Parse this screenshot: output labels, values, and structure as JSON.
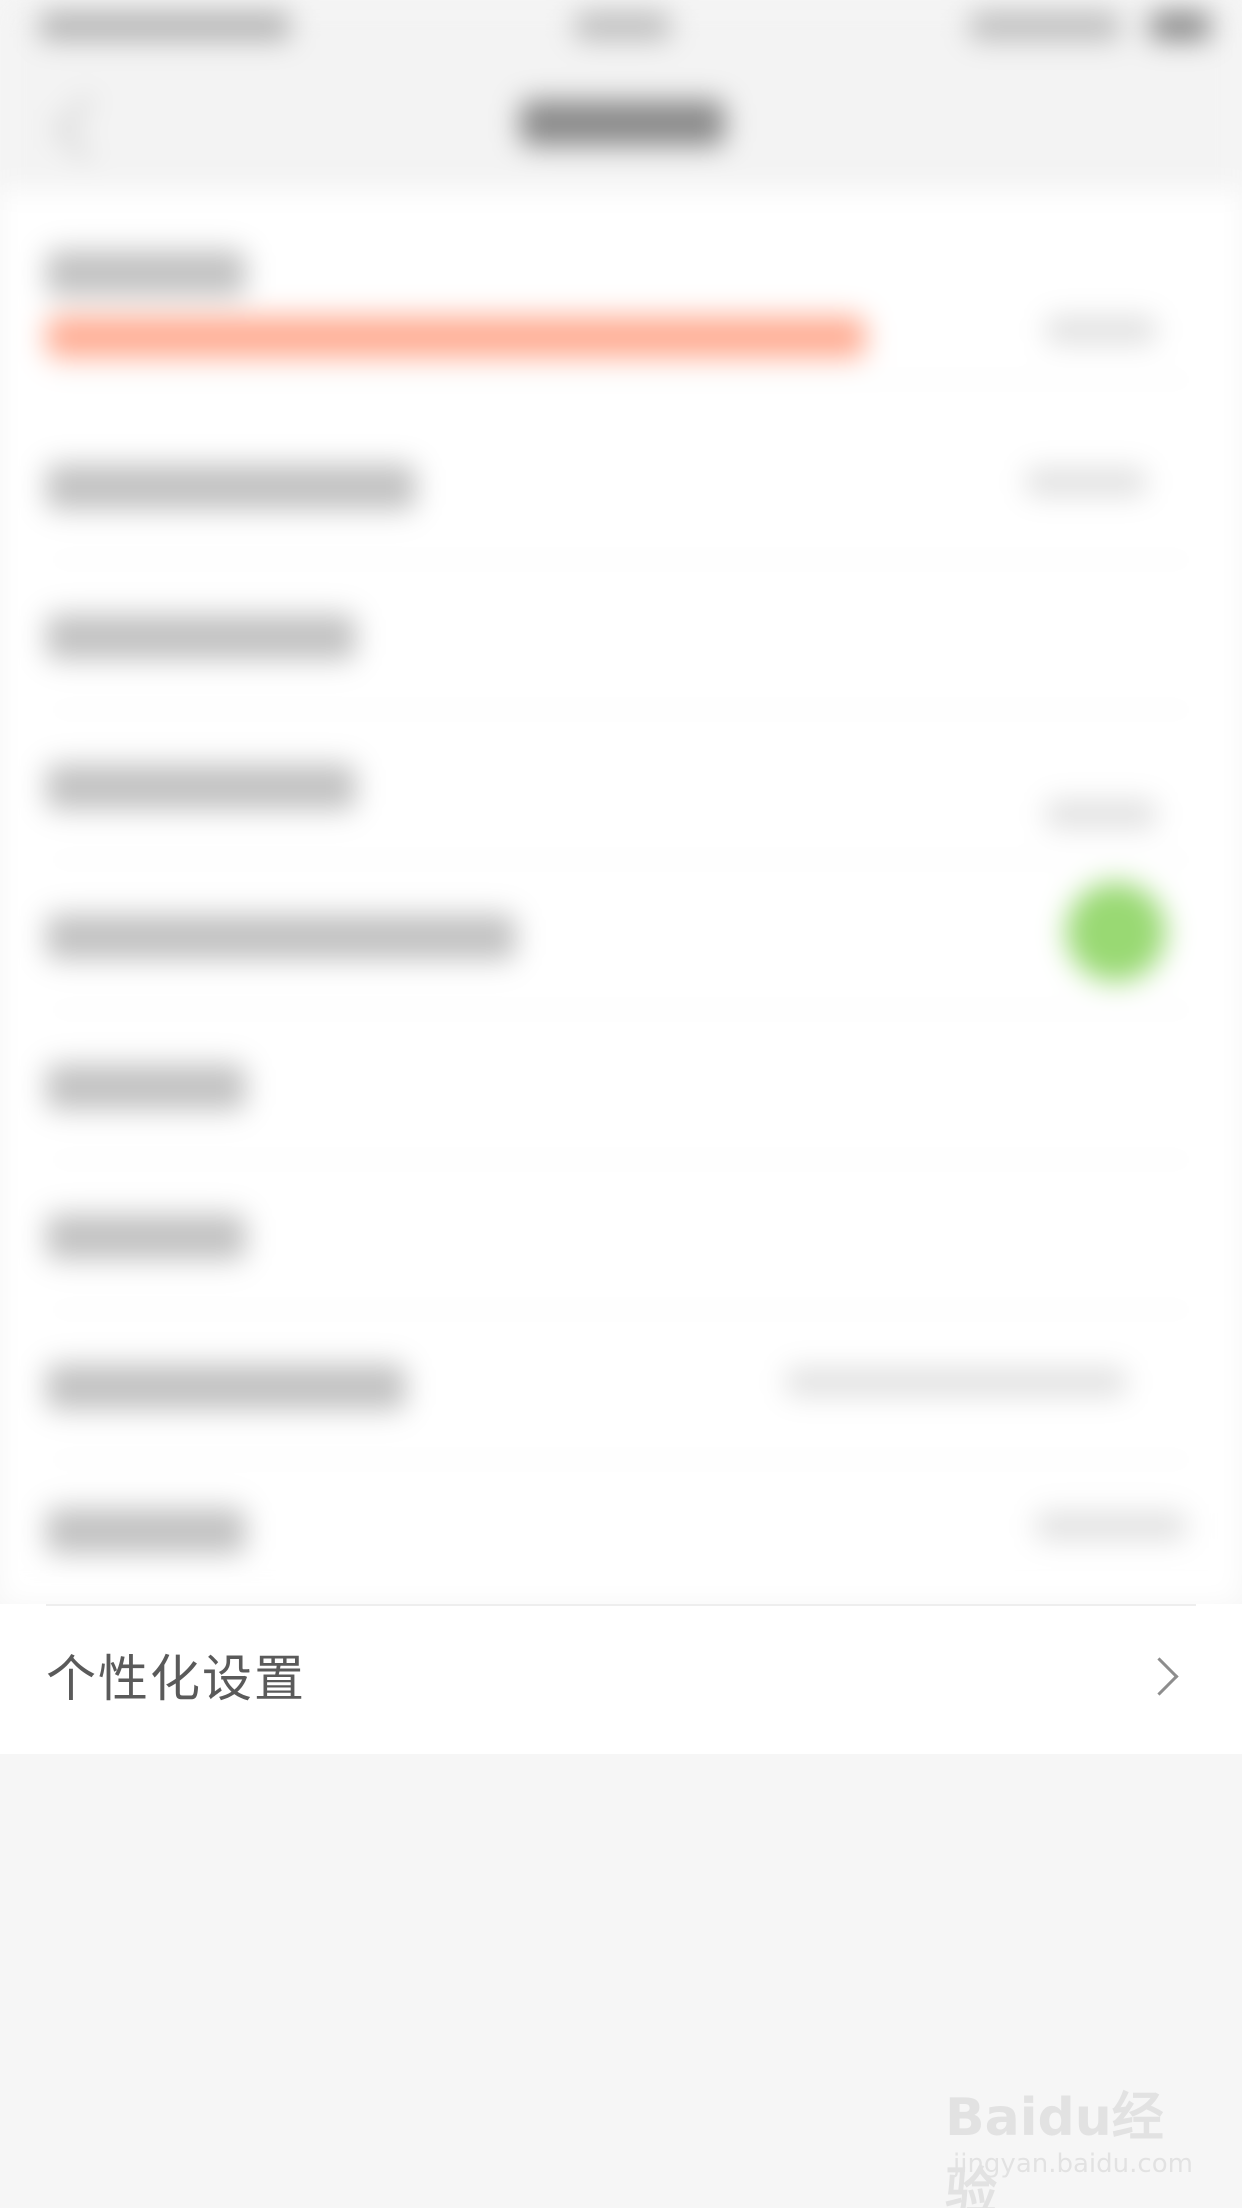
{
  "settings": {
    "personalization_label": "个性化设置"
  },
  "watermark": {
    "logo_text": "Baidu经验",
    "url_text": "jingyan.baidu.com"
  }
}
